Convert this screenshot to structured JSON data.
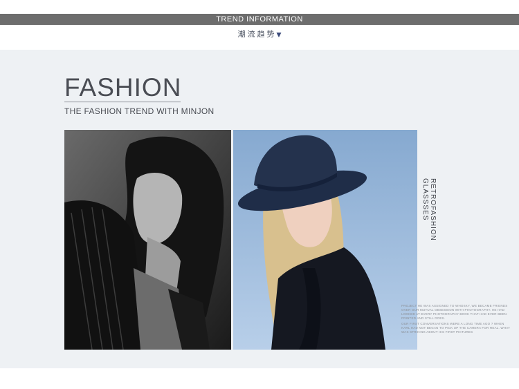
{
  "header": {
    "bar_label": "TREND INFORMATION",
    "subtitle": "潮流趋势",
    "subtitle_arrow": "▼"
  },
  "hero": {
    "headline": "FASHION",
    "tagline": "THE FASHION TREND WITH MINJON"
  },
  "side": {
    "vertical_label": "RETROFASHION GLASSSES",
    "paragraph_1": "PROJECT HE WAS ASSIGNED TO WHOSKY, WE BECAME FRIENDS OVER OUR MUTUAL OBSESSION WITH PHOTOGRAPHY. HE HAD LOOKED AT EVERY PHOTOGRAPHY BOOK THAT HAD EVER BEEN PRINTED AND STILL DOES.",
    "paragraph_2": "OUR FIRST CONVERSATIONS WERE A LONG TIME AGO ? WHEN KARL HAD NOT BEGAN TO PICK UP THE CAMERA FOR REAL. WHAT WAS STRIKING ABOUT HIS FIRST PICTURES"
  },
  "photos": {
    "left_alt": "black and white portrait of woman with dark hair",
    "right_alt": "woman with blonde hair wearing navy fedora hat"
  }
}
